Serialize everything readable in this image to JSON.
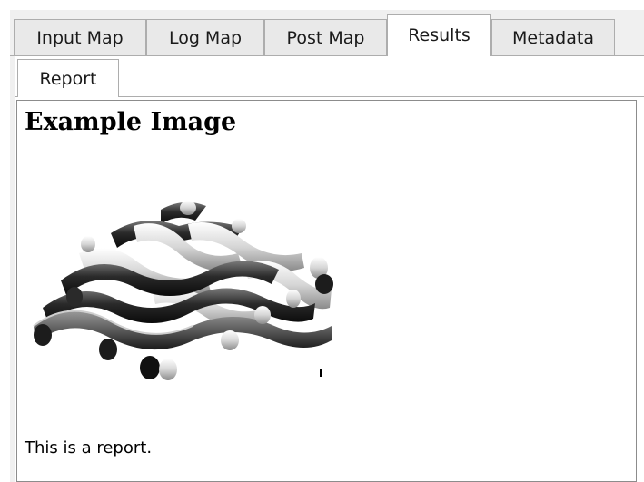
{
  "tabs": [
    {
      "label": "Input Map",
      "active": false
    },
    {
      "label": "Log Map",
      "active": false
    },
    {
      "label": "Post Map",
      "active": false
    },
    {
      "label": "Results",
      "active": true
    },
    {
      "label": "Metadata",
      "active": false
    }
  ],
  "subtabs": [
    {
      "label": "Report",
      "active": true
    }
  ],
  "report": {
    "title": "Example Image",
    "image_icon": "woven-fabric-image",
    "body_text": "This is a report."
  }
}
